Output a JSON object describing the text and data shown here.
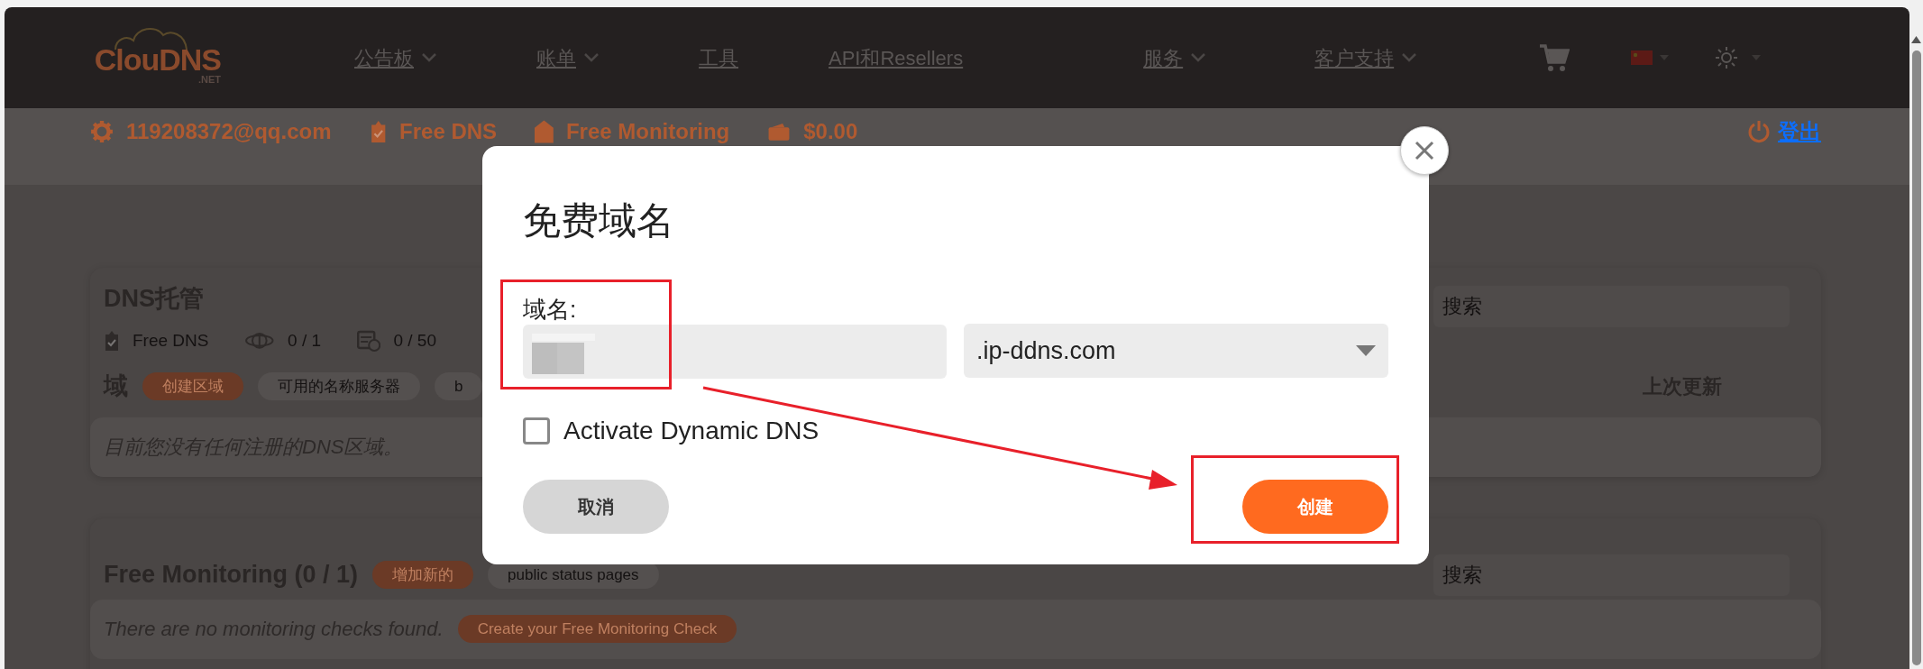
{
  "navbar": {
    "logo": "ClouDNS",
    "logo_suffix": ".NET",
    "items": [
      {
        "label": "公告板",
        "dropdown": true
      },
      {
        "label": "账单",
        "dropdown": true
      },
      {
        "label": "工具",
        "dropdown": false
      },
      {
        "label": "API和Resellers",
        "dropdown": false
      },
      {
        "label": "服务",
        "dropdown": true
      },
      {
        "label": "客户支持",
        "dropdown": true
      }
    ]
  },
  "account_bar": {
    "items": [
      {
        "kind": "gear",
        "label": "119208372@qq.com"
      },
      {
        "kind": "clipboard",
        "label": "Free DNS"
      },
      {
        "kind": "tag",
        "label": "Free Monitoring"
      },
      {
        "kind": "wallet",
        "label": "$0.00"
      }
    ],
    "logout": "登出"
  },
  "dns_card": {
    "title": "DNS托管",
    "stats": [
      {
        "kind": "clipboard",
        "label": "Free DNS"
      },
      {
        "kind": "globe",
        "label": "0 / 1"
      },
      {
        "kind": "server",
        "label": "0 / 50"
      }
    ],
    "search": {
      "placeholder": "搜索"
    },
    "section_label": "域",
    "pills": [
      {
        "label": "创建区域",
        "kind": "primary"
      },
      {
        "label": "可用的名称服务器",
        "kind": "secondary"
      },
      {
        "label": "b",
        "kind": "secondary"
      }
    ],
    "column_header": "上次更新",
    "empty_message": "目前您没有任何注册的DNS区域。"
  },
  "monitoring_card": {
    "title": "Free Monitoring (0 / 1)",
    "pills": [
      {
        "label": "增加新的",
        "kind": "primary"
      },
      {
        "label": "public status pages",
        "kind": "secondary"
      }
    ],
    "search": {
      "placeholder": "搜索"
    },
    "empty_message": "There are no monitoring checks found.",
    "empty_action": "Create your Free Monitoring Check"
  },
  "modal": {
    "title": "免费域名",
    "field_label": "域名:",
    "value_redacted": true,
    "zone": ".ip-ddns.com",
    "checkbox": {
      "label": "Activate Dynamic DNS",
      "checked": false
    },
    "buttons": [
      {
        "label": "取消",
        "kind": "secondary"
      },
      {
        "label": "创建",
        "kind": "primary"
      }
    ]
  },
  "annotations": [
    {
      "kind": "box"
    },
    {
      "kind": "arrow"
    },
    {
      "kind": "box"
    }
  ]
}
